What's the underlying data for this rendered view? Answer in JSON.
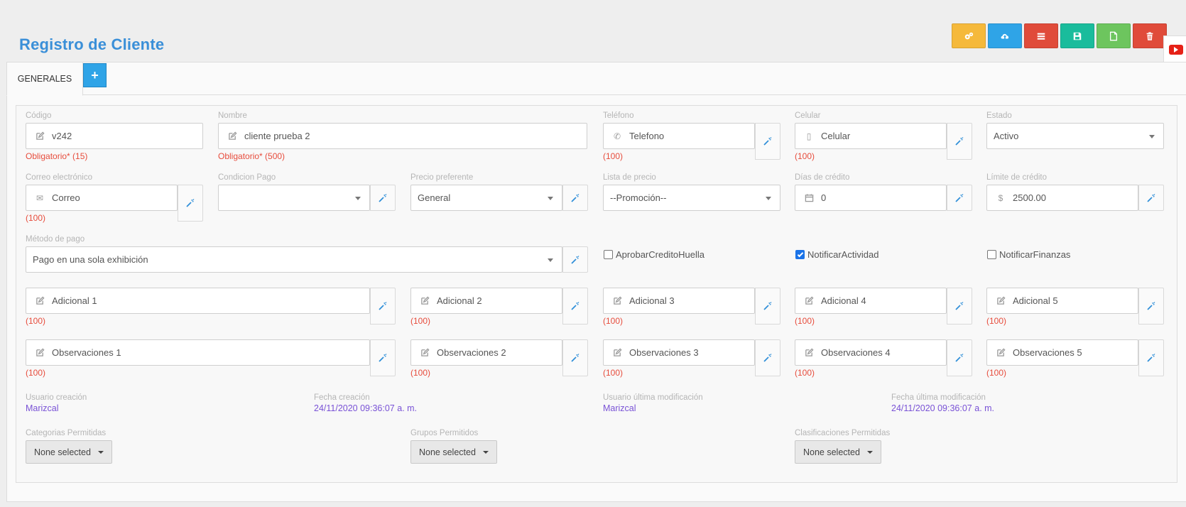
{
  "page": {
    "title": "Registro de Cliente"
  },
  "toolbar": {
    "buttons": [
      {
        "icon": "gears-icon",
        "color": "#f5b93b"
      },
      {
        "icon": "cloud-upload-icon",
        "color": "#2fa4e7"
      },
      {
        "icon": "list-icon",
        "color": "#e04b3a"
      },
      {
        "icon": "save-icon",
        "color": "#1abc9c"
      },
      {
        "icon": "new-file-icon",
        "color": "#6dc55e"
      },
      {
        "icon": "trash-icon",
        "color": "#e04b3a"
      }
    ]
  },
  "video_badge": {
    "icon": "youtube-icon",
    "color": "#e62117"
  },
  "tabs": {
    "active": "GENERALES",
    "add": "+"
  },
  "form": {
    "codigo": {
      "label": "Código",
      "value": "v242",
      "hint": "Obligatorio* (15)"
    },
    "nombre": {
      "label": "Nombre",
      "value": "cliente prueba 2",
      "hint": "Obligatorio* (500)"
    },
    "telefono": {
      "label": "Teléfono",
      "placeholder": "Telefono",
      "hint": "(100)"
    },
    "celular": {
      "label": "Celular",
      "placeholder": "Celular",
      "hint": "(100)"
    },
    "estado": {
      "label": "Estado",
      "value": "Activo"
    },
    "correo": {
      "label": "Correo electrónico",
      "placeholder": "Correo",
      "hint": "(100)"
    },
    "condicion_pago": {
      "label": "Condicion Pago",
      "value": ""
    },
    "precio_preferente": {
      "label": "Precio preferente",
      "value": "General"
    },
    "lista_precio": {
      "label": "Lista de precio",
      "value": "--Promoción--"
    },
    "dias_credito": {
      "label": "Días de crédito",
      "value": "0"
    },
    "limite_credito": {
      "label": "Límite de crédito",
      "symbol": "$",
      "value": "2500.00"
    },
    "metodo_pago": {
      "label": "Método de pago",
      "value": "Pago en una sola exhibición"
    },
    "checkboxes": [
      {
        "label": "AprobarCreditoHuella",
        "checked": false
      },
      {
        "label": "NotificarActividad",
        "checked": true
      },
      {
        "label": "NotificarFinanzas",
        "checked": false
      }
    ],
    "adicionales": [
      {
        "placeholder": "Adicional 1",
        "hint": "(100)"
      },
      {
        "placeholder": "Adicional 2",
        "hint": "(100)"
      },
      {
        "placeholder": "Adicional 3",
        "hint": "(100)"
      },
      {
        "placeholder": "Adicional 4",
        "hint": "(100)"
      },
      {
        "placeholder": "Adicional 5",
        "hint": "(100)"
      }
    ],
    "observaciones": [
      {
        "placeholder": "Observaciones 1",
        "hint": "(100)"
      },
      {
        "placeholder": "Observaciones 2",
        "hint": "(100)"
      },
      {
        "placeholder": "Observaciones 3",
        "hint": "(100)"
      },
      {
        "placeholder": "Observaciones 4",
        "hint": "(100)"
      },
      {
        "placeholder": "Observaciones 5",
        "hint": "(100)"
      }
    ]
  },
  "meta": {
    "usuario_creacion": {
      "label": "Usuario creación",
      "value": "Marizcal"
    },
    "fecha_creacion": {
      "label": "Fecha creación",
      "value": "24/11/2020 09:36:07 a. m."
    },
    "usuario_modificacion": {
      "label": "Usuario última modificación",
      "value": "Marizcal"
    },
    "fecha_modificacion": {
      "label": "Fecha última modificación",
      "value": "24/11/2020 09:36:07 a. m."
    }
  },
  "permisos": {
    "categorias": {
      "label": "Categorias Permitidas",
      "value": "None selected"
    },
    "grupos": {
      "label": "Grupos Permitidos",
      "value": "None selected"
    },
    "clasificaciones": {
      "label": "Clasificaciones Permitidas",
      "value": "None selected"
    }
  }
}
